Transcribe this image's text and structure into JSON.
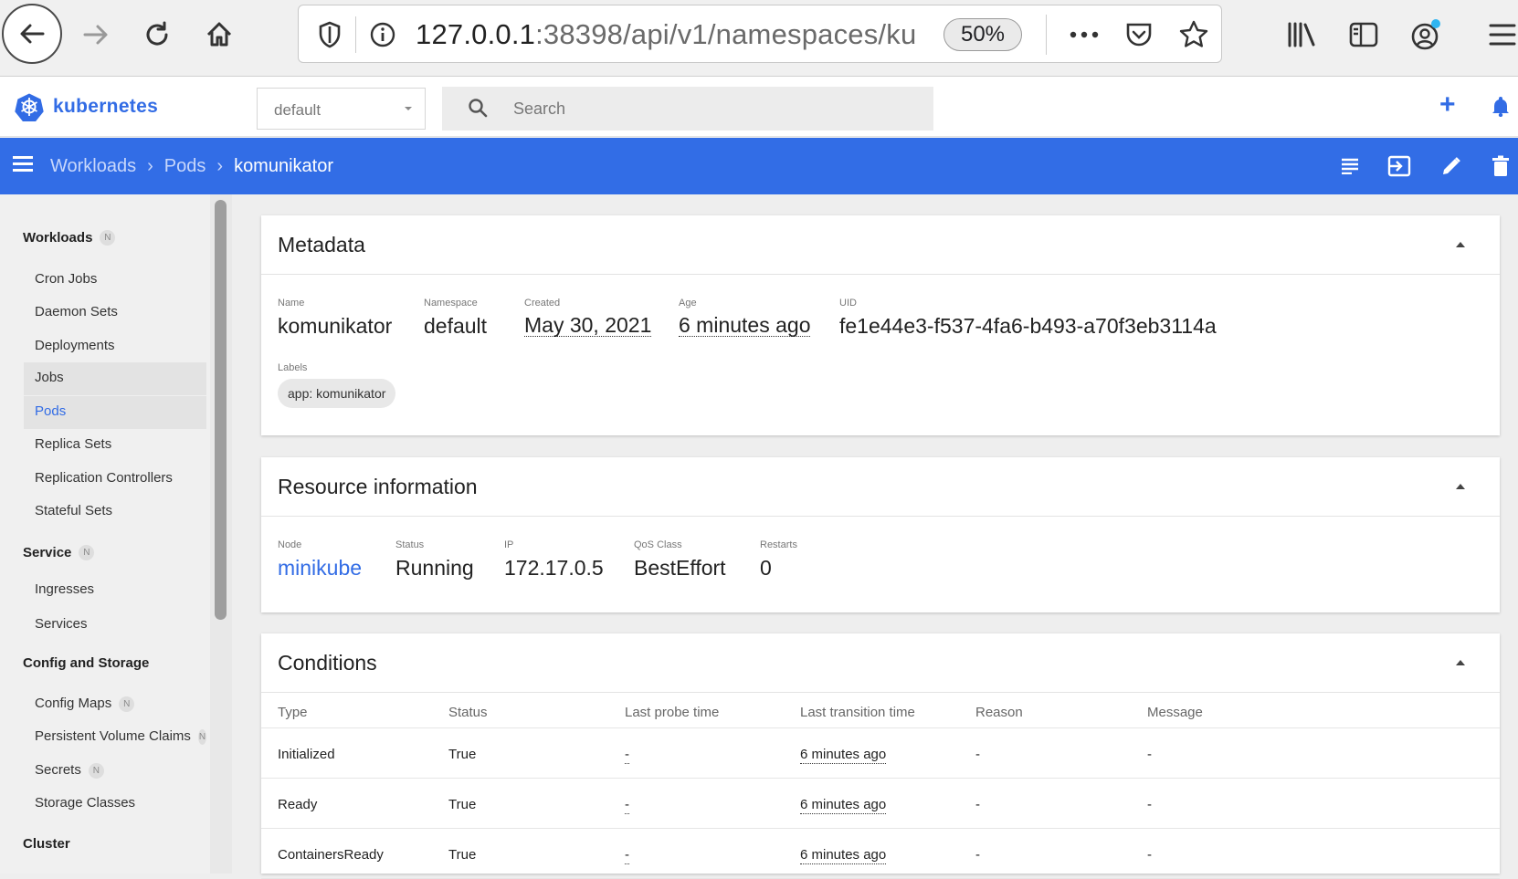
{
  "browser": {
    "url_host": "127.0.0.1",
    "url_rest": ":38398/api/v1/namespaces/ku",
    "zoom": "50%"
  },
  "header": {
    "logo_text": "kubernetes",
    "namespace": "default",
    "search_placeholder": "Search",
    "add_label": "+"
  },
  "breadcrumb": {
    "items": [
      "Workloads",
      "Pods"
    ],
    "current": "komunikator"
  },
  "sidebar": {
    "sections": [
      {
        "label": "Workloads",
        "badge": "N"
      },
      {
        "label": "Service",
        "badge": "N"
      },
      {
        "label": "Config and Storage",
        "badge": ""
      },
      {
        "label": "Cluster",
        "badge": ""
      }
    ],
    "workloads": [
      "Cron Jobs",
      "Daemon Sets",
      "Deployments",
      "Jobs",
      "Pods",
      "Replica Sets",
      "Replication Controllers",
      "Stateful Sets"
    ],
    "service": [
      "Ingresses",
      "Services"
    ],
    "config": [
      {
        "label": "Config Maps",
        "badge": "N"
      },
      {
        "label": "Persistent Volume Claims",
        "badge": "N"
      },
      {
        "label": "Secrets",
        "badge": "N"
      },
      {
        "label": "Storage Classes",
        "badge": ""
      }
    ]
  },
  "metadata": {
    "title": "Metadata",
    "name_label": "Name",
    "name": "komunikator",
    "namespace_label": "Namespace",
    "namespace": "default",
    "created_label": "Created",
    "created": "May 30, 2021",
    "age_label": "Age",
    "age": "6 minutes ago",
    "uid_label": "UID",
    "uid": "fe1e44e3-f537-4fa6-b493-a70f3eb3114a",
    "labels_label": "Labels",
    "label_chip": "app: komunikator"
  },
  "resource": {
    "title": "Resource information",
    "node_label": "Node",
    "node": "minikube",
    "status_label": "Status",
    "status": "Running",
    "ip_label": "IP",
    "ip": "172.17.0.5",
    "qos_label": "QoS Class",
    "qos": "BestEffort",
    "restarts_label": "Restarts",
    "restarts": "0"
  },
  "conditions": {
    "title": "Conditions",
    "columns": [
      "Type",
      "Status",
      "Last probe time",
      "Last transition time",
      "Reason",
      "Message"
    ],
    "rows": [
      [
        "Initialized",
        "True",
        "-",
        "6 minutes ago",
        "-",
        "-"
      ],
      [
        "Ready",
        "True",
        "-",
        "6 minutes ago",
        "-",
        "-"
      ],
      [
        "ContainersReady",
        "True",
        "-",
        "6 minutes ago",
        "-",
        "-"
      ]
    ]
  }
}
